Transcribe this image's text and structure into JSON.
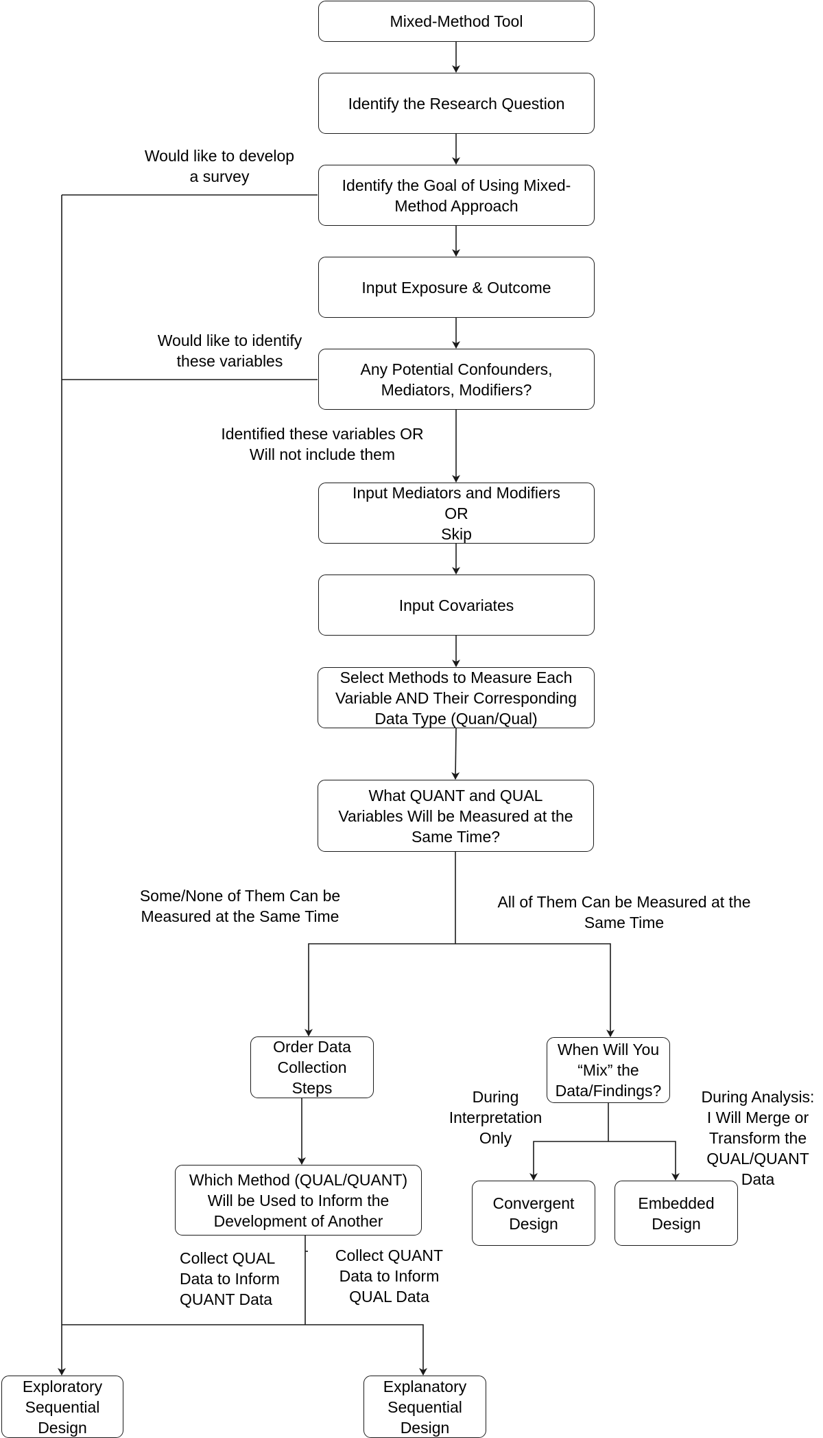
{
  "diagram": {
    "title": "Mixed-Method Tool",
    "nodes": {
      "start": "Mixed-Method Tool",
      "research_question": "Identify the Research Question",
      "goal": "Identify the Goal of Using Mixed-\nMethod Approach",
      "exposure_outcome": "Input Exposure & Outcome",
      "confounders": "Any Potential Confounders,\nMediators, Modifiers?",
      "mediators_modifiers": "Input Mediators and Modifiers\nOR\nSkip",
      "covariates": "Input Covariates",
      "select_methods": "Select Methods to Measure Each\nVariable AND Their Corresponding\nData Type (Quan/Qual)",
      "same_time": "What QUANT and QUAL\nVariables Will be Measured at the\nSame Time?",
      "order_steps": "Order Data\nCollection\nSteps",
      "when_mix": "When Will You\n“Mix” the\nData/Findings?",
      "which_method": "Which Method (QUAL/QUANT)\nWill be Used to Inform the\nDevelopment of Another",
      "convergent": "Convergent\nDesign",
      "embedded": "Embedded\nDesign",
      "exploratory": "Exploratory\nSequential\nDesign",
      "explanatory": "Explanatory\nSequential\nDesign"
    },
    "edge_labels": {
      "develop_survey": "Would like to develop\na survey",
      "identify_variables": "Would like to identify\nthese variables",
      "identified_or_skip": "Identified these variables OR\nWill not include them",
      "some_none": "Some/None of Them Can be\nMeasured at the Same Time",
      "all_same_time": "All of Them Can be Measured at the\nSame Time",
      "during_interpretation": "During\nInterpretation\nOnly",
      "during_analysis": "During Analysis:\nI Will Merge or\nTransform the\nQUAL/QUANT\nData",
      "qual_to_quant": "Collect QUAL\nData to Inform\nQUANT Data",
      "quant_to_qual": "Collect QUANT\nData to Inform\nQUAL Data"
    }
  }
}
